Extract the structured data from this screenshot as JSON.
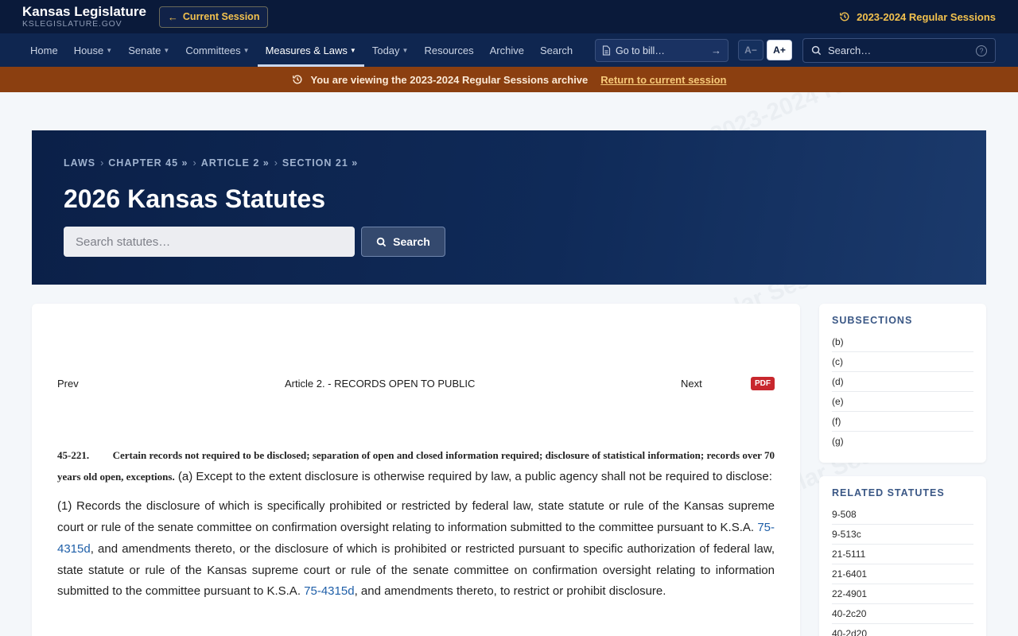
{
  "watermark": "2023-2024 Regular Sessions",
  "header": {
    "brand_title": "Kansas Legislature",
    "brand_sub": "KSLEGISLATURE.GOV",
    "current_session_label": "Current Session",
    "session_label": "2023-2024 Regular Sessions",
    "accent_color": "#f2c14e"
  },
  "nav": {
    "items": [
      {
        "label": "Home",
        "caret": false
      },
      {
        "label": "House",
        "caret": true
      },
      {
        "label": "Senate",
        "caret": true
      },
      {
        "label": "Committees",
        "caret": true
      },
      {
        "label": "Measures & Laws",
        "caret": true,
        "active": true
      },
      {
        "label": "Today",
        "caret": true
      },
      {
        "label": "Resources",
        "caret": false
      },
      {
        "label": "Archive",
        "caret": false
      },
      {
        "label": "Search",
        "caret": false
      }
    ],
    "goto_placeholder": "Go to bill…",
    "font_decrease": "A−",
    "font_increase": "A+",
    "search_placeholder": "Search…",
    "help_icon": "?"
  },
  "archive_banner": {
    "message": "You are viewing the 2023-2024 Regular Sessions archive",
    "link": "Return to current session",
    "bg_color": "#8b3f10"
  },
  "hero": {
    "breadcrumbs": [
      {
        "label": "LAWS",
        "sep": "›"
      },
      {
        "label": "CHAPTER 45 »",
        "sep": "›"
      },
      {
        "label": "ARTICLE 2 »",
        "sep": "›"
      },
      {
        "label": "SECTION 21 »",
        "sep": ""
      }
    ],
    "title": "2026 Kansas Statutes",
    "search_placeholder": "Search statutes…",
    "search_button": "Search"
  },
  "pager": {
    "prev": "Prev",
    "article": "Article 2. - RECORDS OPEN TO PUBLIC",
    "next": "Next",
    "pdf": "PDF"
  },
  "statute": {
    "number": "45-221.",
    "caption": "Certain records not required to be disclosed; separation of open and closed information required; disclosure of statistical information; records over 70 years old open, exceptions.",
    "intro": "(a) Except to the extent disclosure is otherwise required by law, a public agency shall not be required to disclose:",
    "p1_a": "(1)    Records the disclosure of which is specifically prohibited or restricted by federal law, state statute or rule of the Kansas supreme court or rule of the senate committee on confirmation oversight relating to information submitted to the committee pursuant to K.S.A. ",
    "p1_link1": "75-4315d",
    "p1_b": ", and amendments thereto, or the disclosure of which is prohibited or restricted pursuant to specific authorization of federal law, state statute or rule of the Kansas supreme court or rule of the senate committee on confirmation oversight relating to information submitted to the committee pursuant to K.S.A. ",
    "p1_link2": "75-4315d",
    "p1_c": ", and amendments thereto, to restrict or prohibit disclosure."
  },
  "sidebar": {
    "subsections_title": "SUBSECTIONS",
    "subsections": [
      "(b)",
      "(c)",
      "(d)",
      "(e)",
      "(f)",
      "(g)"
    ],
    "related_title": "RELATED STATUTES",
    "related": [
      "9-508",
      "9-513c",
      "21-5111",
      "21-6401",
      "22-4901",
      "40-2c20",
      "40-2d20"
    ]
  }
}
